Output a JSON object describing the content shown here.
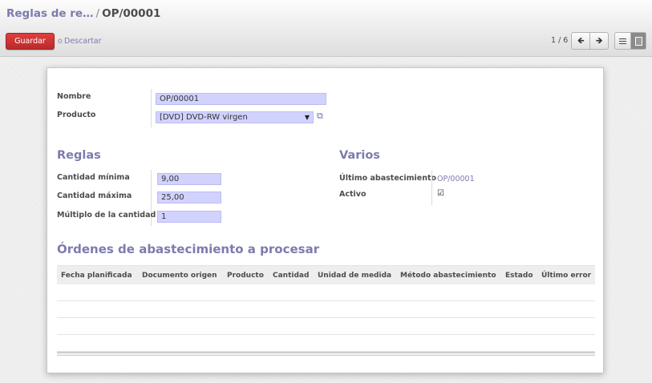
{
  "breadcrumb": {
    "parent": "Reglas de re…",
    "separator": "/",
    "current": "OP/00001"
  },
  "toolbar": {
    "save_label": "Guardar",
    "or_label": "o",
    "discard_label": "Descartar",
    "pager_text": "1 / 6",
    "prev_icon": "arrow-left-icon",
    "next_icon": "arrow-right-icon",
    "views": [
      "list-view-icon",
      "form-view-icon"
    ],
    "active_view": "form"
  },
  "form": {
    "nombre_label": "Nombre",
    "nombre_value": "OP/00001",
    "producto_label": "Producto",
    "producto_value": "[DVD] DVD-RW virgen",
    "reglas_title": "Reglas",
    "cantidad_minima_label": "Cantidad mínima",
    "cantidad_minima_value": "9,00",
    "cantidad_maxima_label": "Cantidad máxima",
    "cantidad_maxima_value": "25,00",
    "multiplo_label": "Múltiplo de la cantidad",
    "multiplo_value": "1",
    "varios_title": "Varios",
    "ultimo_label": "Último abastecimiento",
    "ultimo_value": "OP/00001",
    "activo_label": "Activo",
    "activo_checked": true,
    "ordenes_title": "Órdenes de abastecimiento a procesar"
  },
  "table": {
    "columns": [
      "Fecha planificada",
      "Documento origen",
      "Producto",
      "Cantidad",
      "Unidad de medida",
      "Método abastecimiento",
      "Estado",
      "Último error"
    ],
    "rows": []
  },
  "colors": {
    "accent": "#7c7bad",
    "save": "#c83232",
    "field_bg": "#d2d2ff"
  }
}
